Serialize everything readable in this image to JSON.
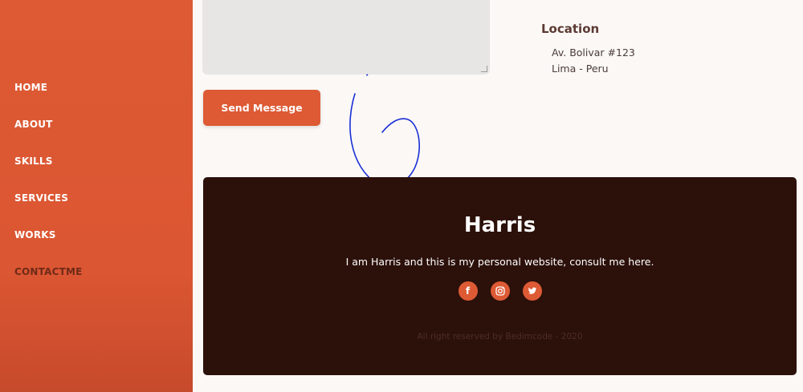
{
  "nav": {
    "items": [
      {
        "label": "HOME"
      },
      {
        "label": "ABOUT"
      },
      {
        "label": "SKILLS"
      },
      {
        "label": "SERVICES"
      },
      {
        "label": "WORKS"
      },
      {
        "label": "CONTACTME"
      }
    ],
    "active_item": "CONTACTME"
  },
  "contact_form": {
    "message_value": "",
    "send_label": "Send Message"
  },
  "location": {
    "title": "Location",
    "line1": "Av. Bolivar #123",
    "line2": "Lima - Peru"
  },
  "footer": {
    "title": "Harris",
    "description": "I am Harris and this is my personal website, consult me here.",
    "socials": [
      {
        "icon": "facebook-icon",
        "glyph": "f"
      },
      {
        "icon": "instagram-icon",
        "glyph": ""
      },
      {
        "icon": "twitter-icon",
        "glyph": ""
      }
    ],
    "copyright": "All right reserved by Bedimcode - 2020"
  },
  "colors": {
    "accent": "#dd5a34",
    "footer_bg": "#2c100a",
    "page_bg": "#fbf8f6",
    "annotation": "#1a2fd6"
  }
}
